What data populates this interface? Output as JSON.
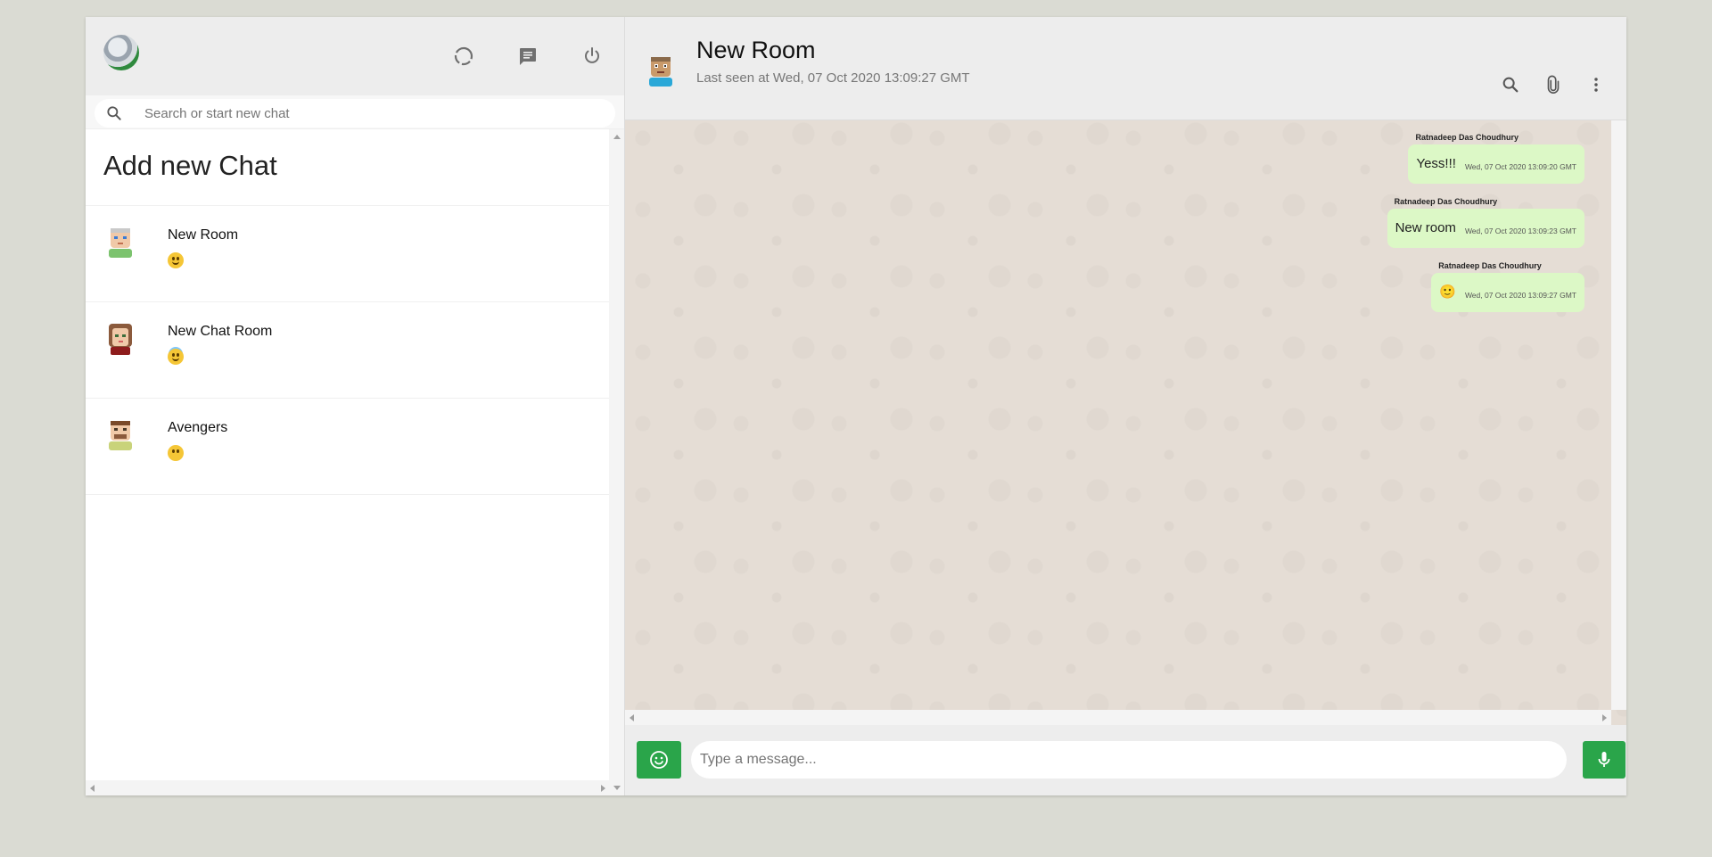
{
  "sidebar": {
    "search": {
      "placeholder": "Search or start new chat"
    },
    "add_new_chat": "Add new Chat",
    "chats": [
      {
        "name": "New Room",
        "last_message": "slightly-smiling-face"
      },
      {
        "name": "New Chat Room",
        "last_message": "smiling-face-with-halo"
      },
      {
        "name": "Avengers",
        "last_message": "face-without-mouth"
      }
    ],
    "icons": [
      "status-icon",
      "new-chat-icon",
      "logout-icon"
    ]
  },
  "chat": {
    "title": "New Room",
    "subtitle": "Last seen at Wed, 07 Oct 2020 13:09:27 GMT",
    "messages": [
      {
        "sender": "Ratnadeep Das Choudhury",
        "text": "Yess!!!",
        "time": "Wed, 07 Oct 2020 13:09:20 GMT"
      },
      {
        "sender": "Ratnadeep Das Choudhury",
        "text": "New room",
        "time": "Wed, 07 Oct 2020 13:09:23 GMT"
      },
      {
        "sender": "Ratnadeep Das Choudhury",
        "text": "🙂",
        "time": "Wed, 07 Oct 2020 13:09:27 GMT"
      }
    ],
    "input": {
      "placeholder": "Type a message..."
    }
  },
  "colors": {
    "accent": "#2aa54a",
    "bubble": "#dcf8c6",
    "header_bg": "#ededed",
    "chat_bg": "#e5ddd5"
  }
}
